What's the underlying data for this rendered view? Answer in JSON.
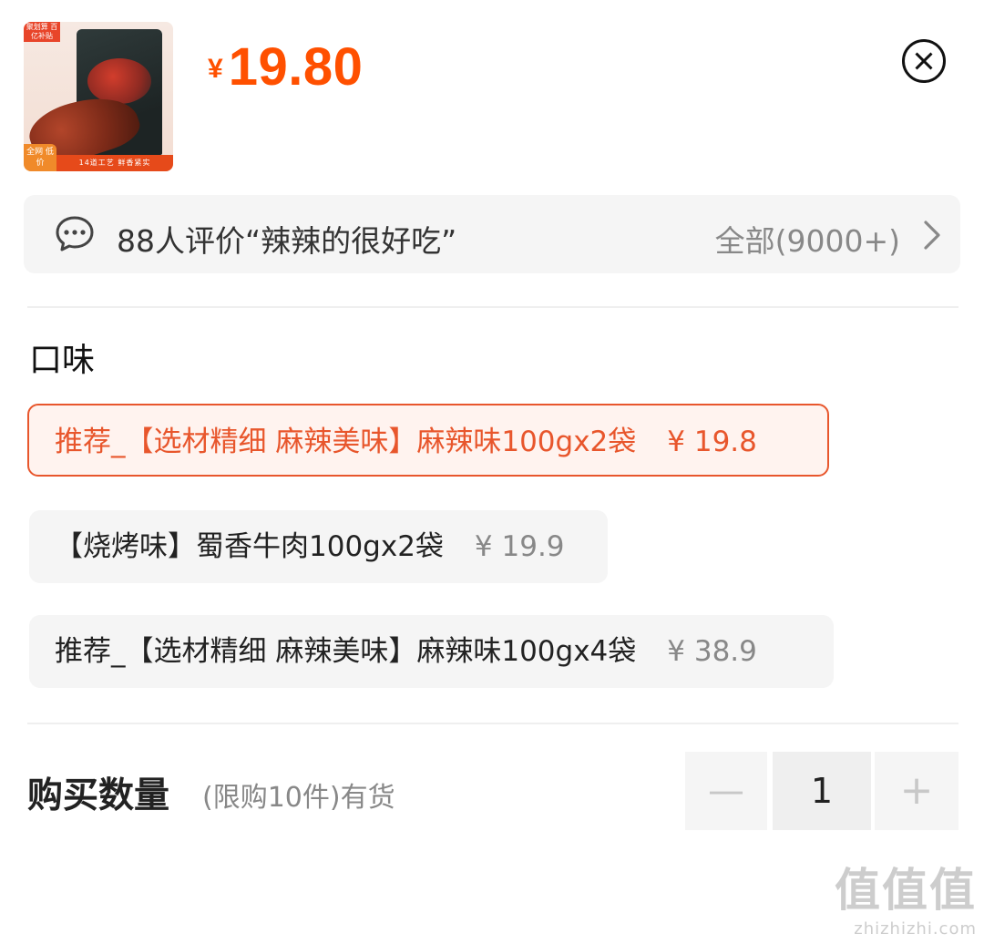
{
  "header": {
    "thumbnail": {
      "badge_top": "聚划算 百亿补贴",
      "badge_corner": "全网 低价",
      "bottom_text": "14道工艺 鲜香紧实"
    },
    "currency": "¥",
    "price": "19.80"
  },
  "review": {
    "text": "88人评价“辣辣的很好吃”",
    "all_label": "全部(9000+)"
  },
  "spec": {
    "title": "口味",
    "options": [
      {
        "label": "推荐_【选材精细 麻辣美味】麻辣味100gx2袋",
        "price": "¥ 19.8",
        "selected": true
      },
      {
        "label": "【烧烤味】蜀香牛肉100gx2袋",
        "price": "¥ 19.9",
        "selected": false
      },
      {
        "label": "推荐_【选材精细 麻辣美味】麻辣味100gx4袋",
        "price": "¥ 38.9",
        "selected": false
      }
    ]
  },
  "quantity": {
    "label": "购买数量",
    "note": "(限购10件)有货",
    "value": "1",
    "minus": "—",
    "plus": "+"
  },
  "watermark": {
    "big": "值值值",
    "small": "zhizhizhi.com"
  },
  "colors": {
    "accent": "#ff5000",
    "selected_border": "#e8562c",
    "panel_bg": "#f5f5f5"
  }
}
